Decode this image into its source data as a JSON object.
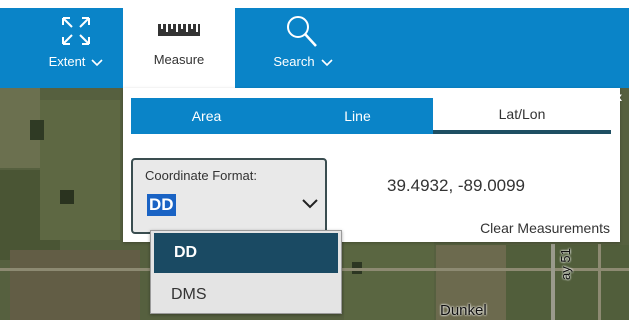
{
  "toolbar": {
    "extent_label": "Extent",
    "measure_label": "Measure",
    "search_label": "Search"
  },
  "panel": {
    "close_label": "x",
    "tabs": [
      {
        "label": "Area"
      },
      {
        "label": "Line"
      },
      {
        "label": "Lat/Lon"
      }
    ],
    "active_tab": "Lat/Lon",
    "coordinate_format_label": "Coordinate Format:",
    "coordinate_format_value": "DD",
    "coordinates": "39.4932, -89.0099",
    "clear_label": "Clear Measurements"
  },
  "dropdown": {
    "options": [
      {
        "label": "DD"
      },
      {
        "label": "DMS"
      }
    ]
  },
  "map": {
    "road_label": "Dunkel",
    "road_label_vertical": "ay 51"
  },
  "colors": {
    "toolbar_blue": "#0a84c8",
    "selected_dark": "#1a4a63",
    "text_highlight": "#1a63c4"
  }
}
